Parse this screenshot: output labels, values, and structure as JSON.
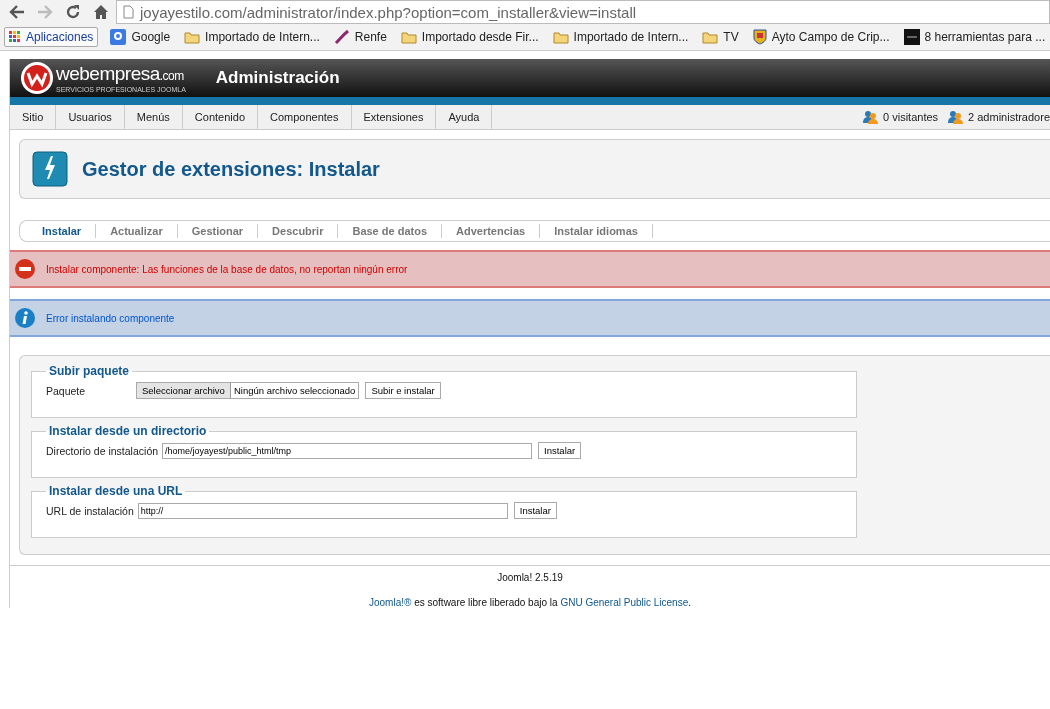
{
  "browser": {
    "url": "joyayestilo.com/administrator/index.php?option=com_installer&view=install",
    "bookmarks": [
      {
        "label": "Aplicaciones",
        "kind": "apps"
      },
      {
        "label": "Google",
        "kind": "google"
      },
      {
        "label": "Importado de Intern...",
        "kind": "folder"
      },
      {
        "label": "Renfe",
        "kind": "renfe"
      },
      {
        "label": "Importado desde Fir...",
        "kind": "folder"
      },
      {
        "label": "Importado de Intern...",
        "kind": "folder"
      },
      {
        "label": "TV",
        "kind": "folder"
      },
      {
        "label": "Ayto Campo de Crip...",
        "kind": "crest"
      },
      {
        "label": "8 herramientas para ...",
        "kind": "dark"
      }
    ]
  },
  "header": {
    "logo_text": "webempresa",
    "logo_domain": ".com",
    "logo_tagline": "SERVICIOS PROFESIONALES JOOMLA",
    "title": "Administración"
  },
  "menu": [
    "Sitio",
    "Usuarios",
    "Menús",
    "Contenido",
    "Componentes",
    "Extensiones",
    "Ayuda"
  ],
  "status": [
    "0 visitantes",
    "2 administradore"
  ],
  "toolbar": {
    "title": "Gestor de extensiones: Instalar"
  },
  "tabs": [
    {
      "label": "Instalar",
      "selected": true
    },
    {
      "label": "Actualizar",
      "selected": false
    },
    {
      "label": "Gestionar",
      "selected": false
    },
    {
      "label": "Descubrir",
      "selected": false
    },
    {
      "label": "Base de datos",
      "selected": false
    },
    {
      "label": "Advertencias",
      "selected": false
    },
    {
      "label": "Instalar idiomas",
      "selected": false
    }
  ],
  "messages": [
    {
      "kind": "error",
      "text": "Instalar componente: Las funciones de la base de datos, no reportan ningún error"
    },
    {
      "kind": "info",
      "text": "Error instalando componente"
    }
  ],
  "fieldsets": [
    {
      "legend": "Subir paquete",
      "label": "Paquete",
      "kind": "file",
      "file_button": "Seleccionar archivo",
      "file_status": "Ningún archivo seleccionado",
      "button": "Subir e instalar"
    },
    {
      "legend": "Instalar desde un directorio",
      "label": "Directorio de instalación",
      "kind": "text",
      "value": "/home/joyayest/public_html/tmp",
      "button": "Instalar"
    },
    {
      "legend": "Instalar desde una URL",
      "label": "URL de instalación",
      "kind": "url",
      "value": "http://",
      "button": "Instalar"
    }
  ],
  "footer": {
    "version": "Joomla! 2.5.19",
    "link1": "Joomla!®",
    "middle": " es software libre liberado bajo la ",
    "link2": "GNU General Public License",
    "end": "."
  }
}
